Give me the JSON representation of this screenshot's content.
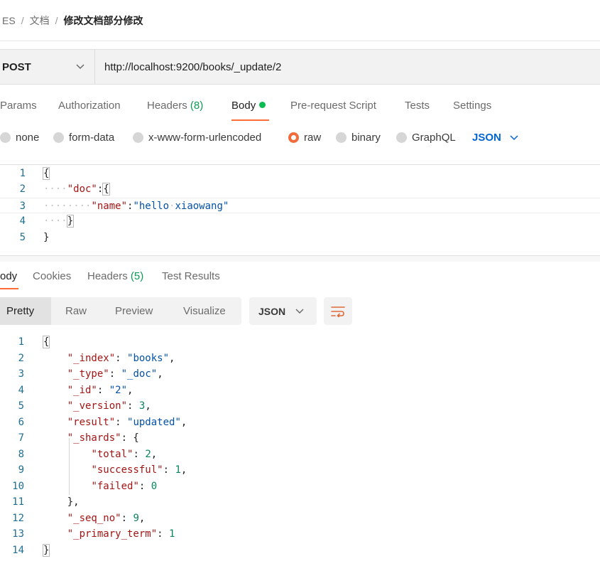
{
  "breadcrumb": {
    "root": "ES",
    "sep": "/",
    "parent": "文档",
    "current": "修改文档部分修改"
  },
  "request": {
    "method": "POST",
    "url": "http://localhost:9200/books/_update/2"
  },
  "request_tabs": {
    "params": "Params",
    "authorization": "Authorization",
    "headers": "Headers",
    "headers_count": "(8)",
    "body": "Body",
    "pre_request": "Pre-request Script",
    "tests": "Tests",
    "settings": "Settings"
  },
  "body_types": {
    "none": "none",
    "form_data": "form-data",
    "urlencoded": "x-www-form-urlencoded",
    "raw": "raw",
    "binary": "binary",
    "graphql": "GraphQL",
    "selected": "raw",
    "language": "JSON"
  },
  "request_body": {
    "line_numbers": [
      "1",
      "2",
      "3",
      "4",
      "5"
    ],
    "lines": [
      "{",
      "\"doc\":{",
      "\"name\":\"hello xiaowang\"",
      "}",
      "}"
    ]
  },
  "response_tabs": {
    "body": "ody",
    "cookies": "Cookies",
    "headers": "Headers",
    "headers_count": "(5)",
    "test_results": "Test Results"
  },
  "response_view": {
    "pretty": "Pretty",
    "raw": "Raw",
    "preview": "Preview",
    "visualize": "Visualize",
    "format": "JSON"
  },
  "response_body": {
    "line_numbers": [
      "1",
      "2",
      "3",
      "4",
      "5",
      "6",
      "7",
      "8",
      "9",
      "10",
      "11",
      "12",
      "13",
      "14"
    ],
    "_index": "books",
    "_type": "_doc",
    "_id": "2",
    "_version": 3,
    "result": "updated",
    "total": 2,
    "successful": 1,
    "failed": 0,
    "_seq_no": 9,
    "_primary_term": 1
  },
  "colors": {
    "accent": "#ff6c37",
    "link_blue": "#0265d2",
    "status_green": "#0cbb52"
  }
}
